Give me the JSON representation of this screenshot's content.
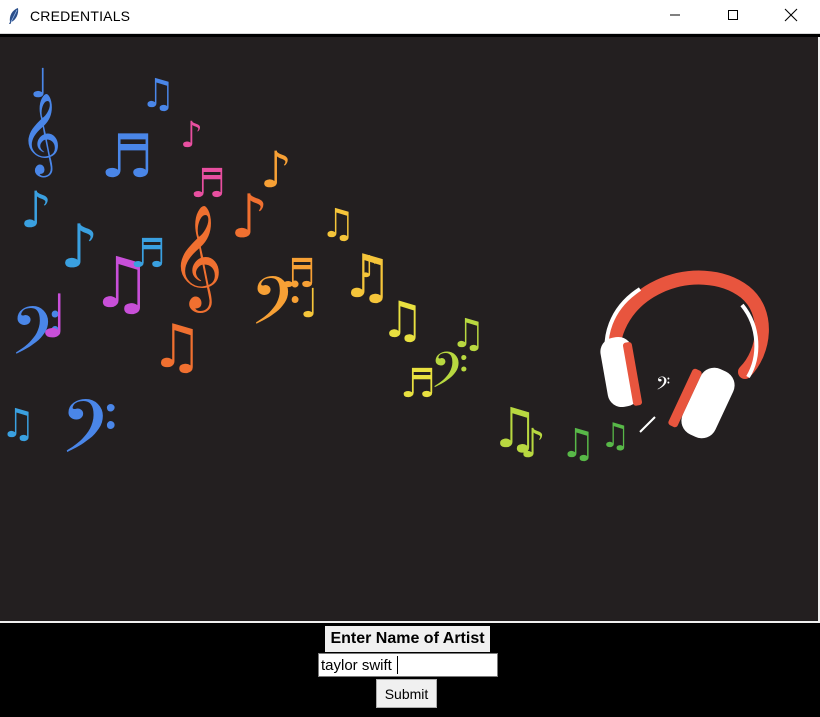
{
  "window": {
    "title": "CREDENTIALS",
    "icon": "feather-icon",
    "controls": [
      "minimize-icon",
      "maximize-icon",
      "close-icon"
    ]
  },
  "artwork": {
    "description_icon": "music-notes-headphones-image",
    "background_color": "#231f20",
    "palette": [
      "#4a86e8",
      "#3aa0e0",
      "#c84fd8",
      "#e84fa0",
      "#f07030",
      "#f7a035",
      "#f5c53a",
      "#e8e040",
      "#b8d840",
      "#58b848",
      "#e85a40"
    ]
  },
  "form": {
    "label": "Enter Name of Artist",
    "entry_value": "taylor swift",
    "submit_label": "Submit"
  }
}
